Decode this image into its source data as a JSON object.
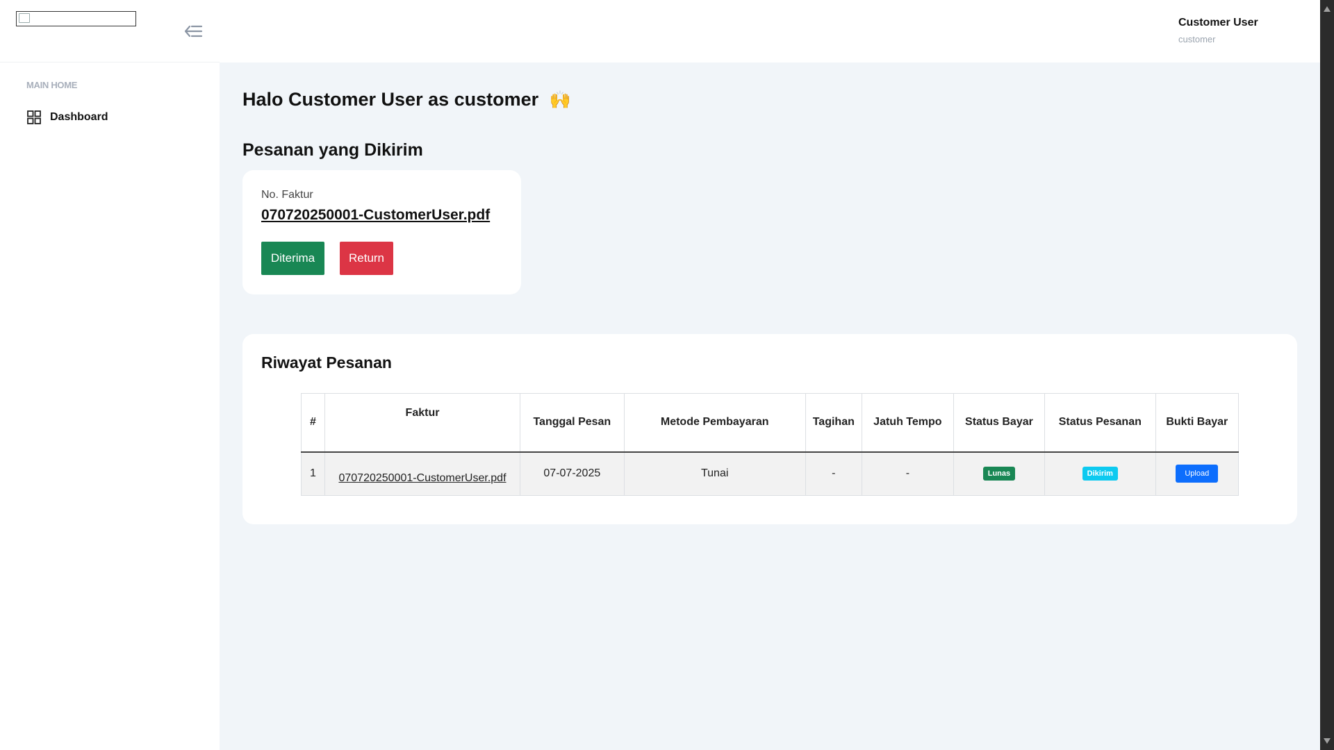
{
  "sidebar": {
    "logo_alt": "",
    "section_label": "MAIN HOME",
    "items": [
      {
        "label": "Dashboard",
        "icon": "grid-icon"
      }
    ]
  },
  "header": {
    "user_name": "Customer User",
    "user_role": "customer"
  },
  "main": {
    "greeting": "Halo Customer User as customer",
    "greeting_emoji": "🙌",
    "shipped_title": "Pesanan yang Dikirim",
    "invoice_card": {
      "label": "No. Faktur",
      "invoice": "070720250001-CustomerUser.pdf",
      "accept_label": "Diterima",
      "return_label": "Return"
    },
    "history": {
      "title": "Riwayat Pesanan",
      "columns": [
        "#",
        "Faktur",
        "Tanggal Pesan",
        "Metode Pembayaran",
        "Tagihan",
        "Jatuh Tempo",
        "Status Bayar",
        "Status Pesanan",
        "Bukti Bayar"
      ],
      "rows": [
        {
          "no": "1",
          "faktur": "070720250001-CustomerUser.pdf",
          "tanggal": "07-07-2025",
          "metode": "Tunai",
          "tagihan": "-",
          "jatuh_tempo": "-",
          "status_bayar": "Lunas",
          "status_pesanan": "Dikirim",
          "bukti_bayar": "Upload"
        }
      ]
    }
  },
  "colors": {
    "success": "#198754",
    "danger": "#dc3545",
    "info": "#0dcaf0",
    "primary": "#0d6efd",
    "background": "#f1f5f9"
  }
}
